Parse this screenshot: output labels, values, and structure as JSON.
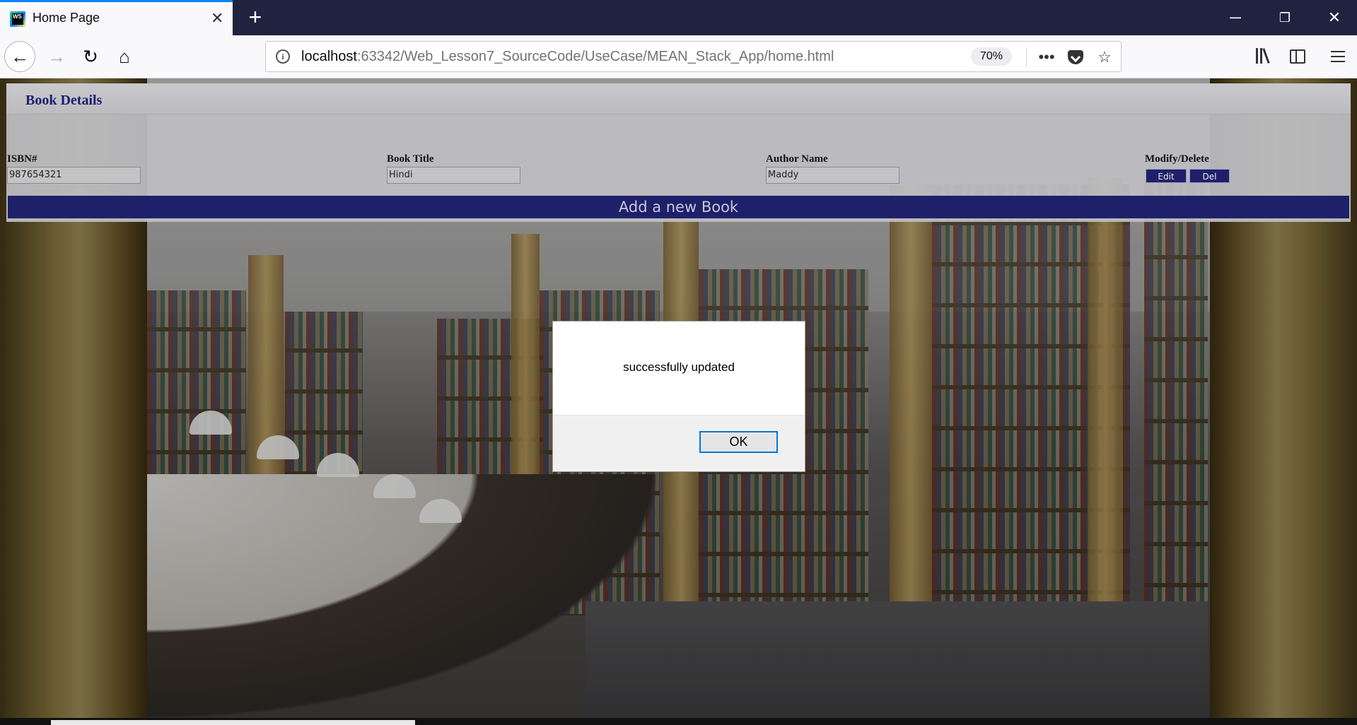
{
  "browser": {
    "tab_title": "Home Page",
    "tab_favicon_text": "WS",
    "url_host": "localhost",
    "url_rest": ":63342/Web_Lesson7_SourceCode/UseCase/MEAN_Stack_App/home.html",
    "zoom": "70%"
  },
  "icons": [
    "close-icon",
    "plus-icon",
    "minimize-icon",
    "restore-icon",
    "back-icon",
    "forward-icon",
    "reload-icon",
    "home-icon",
    "info-icon",
    "more-icon",
    "pocket-icon",
    "star-icon",
    "library-icon",
    "sidebar-icon",
    "menu-icon"
  ],
  "colors": {
    "tabbar": "#202340",
    "accent": "#0a84ff",
    "navy": "#1e206a",
    "title": "#1b1f6e",
    "focus": "#0078d7"
  },
  "panel": {
    "title": "Book Details",
    "columns": {
      "isbn": "ISBN#",
      "title": "Book Title",
      "author": "Author Name",
      "actions": "Modify/Delete"
    },
    "row": {
      "isbn": "987654321",
      "title": "Hindi",
      "author": "Maddy"
    },
    "edit_label": "Edit",
    "delete_label": "Del",
    "add_label": "Add a new Book"
  },
  "dialog": {
    "message": "successfully updated",
    "ok_label": "OK"
  }
}
